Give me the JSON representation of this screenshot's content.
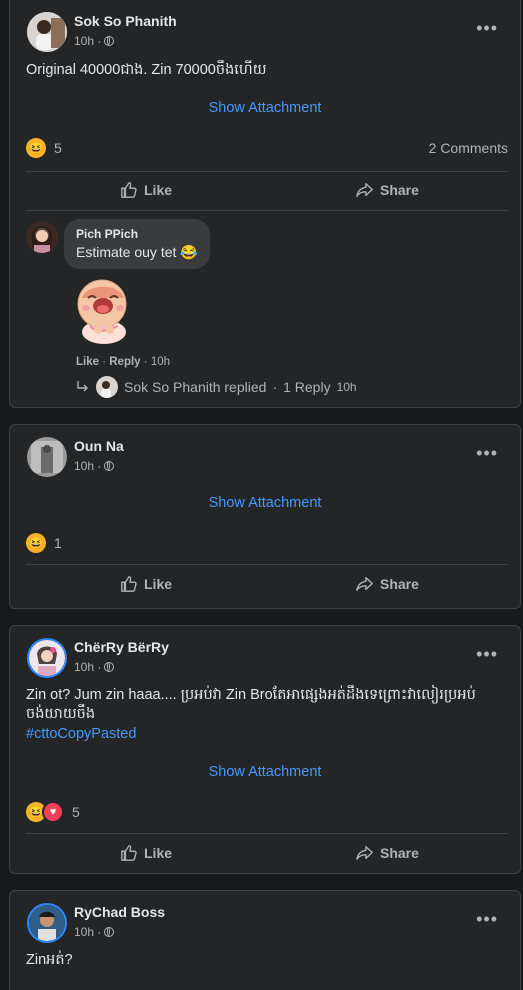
{
  "posts": [
    {
      "author": "Sok So Phanith",
      "time": "10h ·",
      "text": "Original 40000ជាង. Zin  70000ចឹងហើយ",
      "attachment": "Show Attachment",
      "reaction_count": "5",
      "comments_count": "2 Comments",
      "like": "Like",
      "share": "Share",
      "comment": {
        "author": "Pich PPich",
        "text": "Estimate ouy tet 😂",
        "like": "Like",
        "reply": "Reply",
        "time": "10h",
        "replied_by": "Sok So Phanith replied",
        "reply_count": "1 Reply",
        "reply_time": "10h"
      }
    },
    {
      "author": "Oun Na",
      "time": "10h ·",
      "attachment": "Show Attachment",
      "reaction_count": "1",
      "like": "Like",
      "share": "Share"
    },
    {
      "author": "ChërRy BërRy",
      "time": "10h ·",
      "text": "Zin ot? Jum zin haaa.... ប្រអប់វា Zin Broតែអាផ្សេងអត់ដឹងទេព្រោះវាលៀរប្រអប់ ចង់យាយចឹង",
      "hashtag": "#cttoCopyPasted",
      "attachment": "Show Attachment",
      "reaction_count": "5",
      "like": "Like",
      "share": "Share"
    },
    {
      "author": "RyChad Boss",
      "time": "10h ·",
      "text": "Zinអត់?"
    }
  ],
  "icons": {
    "haha": "haha-reaction-icon",
    "love": "love-reaction-icon",
    "like": "thumbs-up-icon",
    "share": "share-arrow-icon",
    "globe": "globe-icon",
    "more": "more-dots-icon"
  },
  "colors": {
    "background": "#18191a",
    "card": "#242526",
    "link": "#4599ff",
    "haha": "#f7b125",
    "love": "#f33e58"
  }
}
